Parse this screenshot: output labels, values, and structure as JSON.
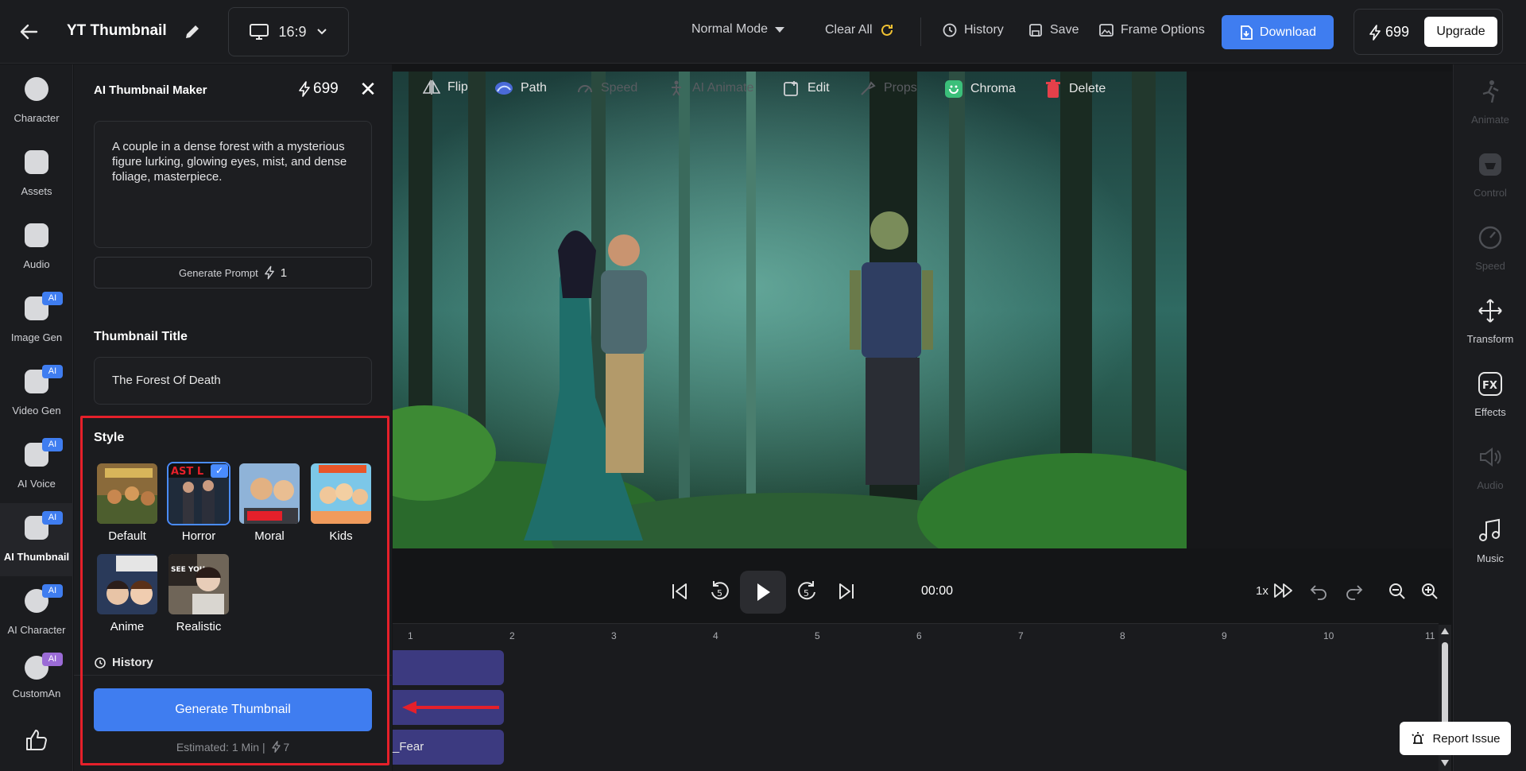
{
  "topbar": {
    "title": "YT Thumbnail",
    "aspect_ratio": "16:9",
    "mode": "Normal Mode",
    "clear_all": "Clear All",
    "history": "History",
    "save": "Save",
    "frame_options": "Frame Options",
    "download": "Download",
    "credits": "699",
    "upgrade": "Upgrade"
  },
  "leftnav": {
    "items": [
      {
        "label": "Character",
        "ai": false
      },
      {
        "label": "Assets",
        "ai": false
      },
      {
        "label": "Audio",
        "ai": false
      },
      {
        "label": "Image Gen",
        "ai": true
      },
      {
        "label": "Video Gen",
        "ai": true
      },
      {
        "label": "AI Voice",
        "ai": true
      },
      {
        "label": "AI Thumbnail",
        "ai": true
      },
      {
        "label": "AI Character",
        "ai": true
      },
      {
        "label": "CustomAn",
        "ai": true
      }
    ],
    "ai_badge": "AI"
  },
  "panel": {
    "title": "AI Thumbnail Maker",
    "credits": "699",
    "prompt": "A couple in a dense forest with a mysterious figure lurking, glowing eyes, mist, and dense foliage, masterpiece.",
    "generate_prompt": "Generate Prompt",
    "generate_prompt_cost": "1",
    "thumbnail_title_label": "Thumbnail Title",
    "thumbnail_title_value": "The Forest Of Death",
    "style_label": "Style",
    "styles": [
      {
        "name": "Default",
        "selected": false
      },
      {
        "name": "Horror",
        "selected": true
      },
      {
        "name": "Moral",
        "selected": false
      },
      {
        "name": "Kids",
        "selected": false
      },
      {
        "name": "Anime",
        "selected": false
      },
      {
        "name": "Realistic",
        "selected": false
      }
    ],
    "history": "History",
    "generate_button": "Generate Thumbnail",
    "estimated": "Estimated: 1 Min |",
    "estimated_cost": "7"
  },
  "toolbar": {
    "tools": [
      {
        "label": "Flip",
        "enabled": true
      },
      {
        "label": "Path",
        "enabled": true
      },
      {
        "label": "Speed",
        "enabled": false
      },
      {
        "label": "AI Animate",
        "enabled": false
      },
      {
        "label": "Edit",
        "enabled": true
      },
      {
        "label": "Props",
        "enabled": false
      },
      {
        "label": "Chroma",
        "enabled": true
      },
      {
        "label": "Delete",
        "enabled": true
      }
    ]
  },
  "playback": {
    "time": "00:00",
    "speed": "1x"
  },
  "timeline": {
    "ticks": [
      "1",
      "2",
      "3",
      "4",
      "5",
      "6",
      "7",
      "8",
      "9",
      "10",
      "11"
    ],
    "track_label": "_Fear"
  },
  "rightnav": {
    "items": [
      {
        "label": "Animate",
        "enabled": false
      },
      {
        "label": "Control",
        "enabled": false
      },
      {
        "label": "Speed",
        "enabled": false
      },
      {
        "label": "Transform",
        "enabled": true
      },
      {
        "label": "Effects",
        "enabled": true
      },
      {
        "label": "Audio",
        "enabled": false
      },
      {
        "label": "Music",
        "enabled": true
      }
    ]
  },
  "report_issue": "Report Issue",
  "colors": {
    "accent": "#3f7df0",
    "highlight": "#e5202a",
    "background": "#141517"
  }
}
